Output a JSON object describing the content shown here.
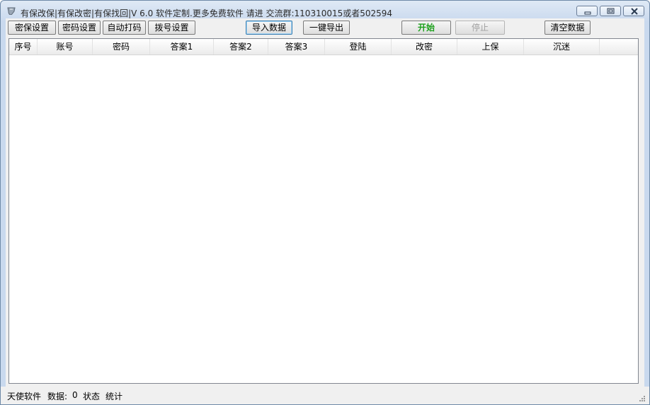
{
  "window": {
    "title": "有保改保|有保改密|有保找回|V 6.0 软件定制.更多免费软件 请进 交流群:110310015或者502594"
  },
  "toolbar": {
    "mibao_settings": "密保设置",
    "password_settings": "密码设置",
    "auto_captcha": "自动打码",
    "dial_settings": "拨号设置",
    "import_data": "导入数据",
    "one_click_export": "一键导出",
    "start": "开始",
    "stop": "停止",
    "clear_data": "清空数据"
  },
  "table": {
    "columns": [
      "序号",
      "账号",
      "密码",
      "答案1",
      "答案2",
      "答案3",
      "登陆",
      "改密",
      "上保",
      "沉迷"
    ],
    "rows": []
  },
  "statusbar": {
    "brand": "天使软件",
    "data_label": "数据:",
    "data_count": "0",
    "status_label": "状态",
    "stats_label": "统计"
  },
  "colors": {
    "start_text": "#1ca01c",
    "disabled_text": "#a0a0a0",
    "title_gradient_top": "#dfe9f5",
    "title_gradient_bottom": "#c9d9ee"
  },
  "icons": [
    "app-icon",
    "minimize-icon",
    "maximize-icon",
    "close-icon",
    "resize-grip-icon"
  ]
}
